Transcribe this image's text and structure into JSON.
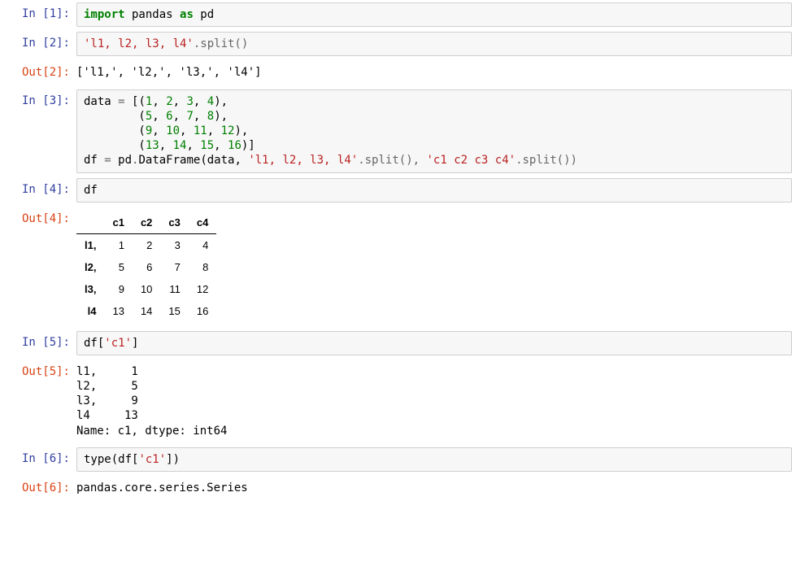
{
  "cells": [
    {
      "in_prompt": "In [1]:",
      "kind": "code"
    },
    {
      "in_prompt": "In [2]:",
      "out_prompt": "Out[2]:",
      "kind": "code_out_text",
      "out_text": "['l1,', 'l2,', 'l3,', 'l4']"
    },
    {
      "in_prompt": "In [3]:",
      "kind": "code"
    },
    {
      "in_prompt": "In [4]:",
      "out_prompt": "Out[4]:",
      "kind": "code_out_html"
    },
    {
      "in_prompt": "In [5]:",
      "out_prompt": "Out[5]:",
      "kind": "code_out_text",
      "out_text": "l1,     1\nl2,     5\nl3,     9\nl4     13\nName: c1, dtype: int64"
    },
    {
      "in_prompt": "In [6]:",
      "out_prompt": "Out[6]:",
      "kind": "code_out_text",
      "out_text": "pandas.core.series.Series"
    }
  ],
  "code1": {
    "t_import": "import",
    "t_pandas": " pandas ",
    "t_as": "as",
    "t_pd": " pd"
  },
  "code2": {
    "t_str": "'l1, l2, l3, l4'",
    "t_split": ".split()"
  },
  "code3": {
    "l1a": "data ",
    "l1op": "=",
    "l1b": " [(",
    "l1n1": "1",
    "l1c": ", ",
    "l1n2": "2",
    "l1n3": "3",
    "l1n4": "4",
    "l1d": "),",
    "l2a": "        (",
    "l2n1": "5",
    "l2n2": "6",
    "l2n3": "7",
    "l2n4": "8",
    "l2d": "),",
    "l3a": "        (",
    "l3n1": "9",
    "l3n2": "10",
    "l3n3": "11",
    "l3n4": "12",
    "l3d": "),",
    "l4a": "        (",
    "l4n1": "13",
    "l4n2": "14",
    "l4n3": "15",
    "l4n4": "16",
    "l4d": ")]",
    "l5a": "df ",
    "l5op": "=",
    "l5b": " pd",
    "l5dot": ".",
    "l5fn": "DataFrame(data, ",
    "l5s1": "'l1, l2, l3, l4'",
    "l5sp1": ".split(), ",
    "l5s2": "'c1 c2 c3 c4'",
    "l5sp2": ".split())"
  },
  "code4": {
    "t": "df"
  },
  "code5": {
    "t1": "df[",
    "t2": "'c1'",
    "t3": "]"
  },
  "code6": {
    "t1": "type(df[",
    "t2": "'c1'",
    "t3": "])"
  },
  "df": {
    "cols": [
      "c1",
      "c2",
      "c3",
      "c4"
    ],
    "index": [
      "l1,",
      "l2,",
      "l3,",
      "l4"
    ],
    "rows": [
      [
        "1",
        "2",
        "3",
        "4"
      ],
      [
        "5",
        "6",
        "7",
        "8"
      ],
      [
        "9",
        "10",
        "11",
        "12"
      ],
      [
        "13",
        "14",
        "15",
        "16"
      ]
    ]
  }
}
